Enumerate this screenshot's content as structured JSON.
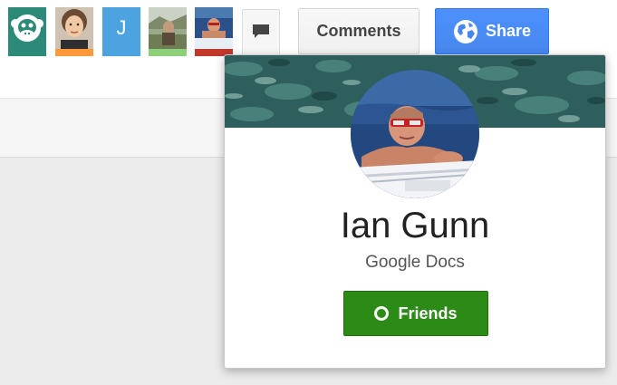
{
  "toolbar": {
    "collaborators": [
      {
        "id": "collaborator-anonymous",
        "icon": "anonymous-animal-icon",
        "bar_color": "#2c8a78"
      },
      {
        "id": "collaborator-woman",
        "icon": "user-photo-avatar",
        "bar_color": "#ff9a3c"
      },
      {
        "id": "collaborator-j",
        "initial": "J",
        "bar_color": "#4da3e0"
      },
      {
        "id": "collaborator-outdoor",
        "icon": "user-photo-avatar",
        "bar_color": "#8ed07a"
      },
      {
        "id": "collaborator-ian",
        "icon": "user-photo-avatar",
        "bar_color": "#c0392b"
      }
    ],
    "chat_icon": "chat-bubble-icon",
    "comments_label": "Comments",
    "share_label": "Share",
    "share_icon": "globe-icon",
    "share_color": "#4d90fe"
  },
  "profile_card": {
    "name": "Ian Gunn",
    "source": "Google Docs",
    "friends_label": "Friends",
    "friends_icon": "circle-ring-icon",
    "friends_color": "#2c8a17"
  }
}
